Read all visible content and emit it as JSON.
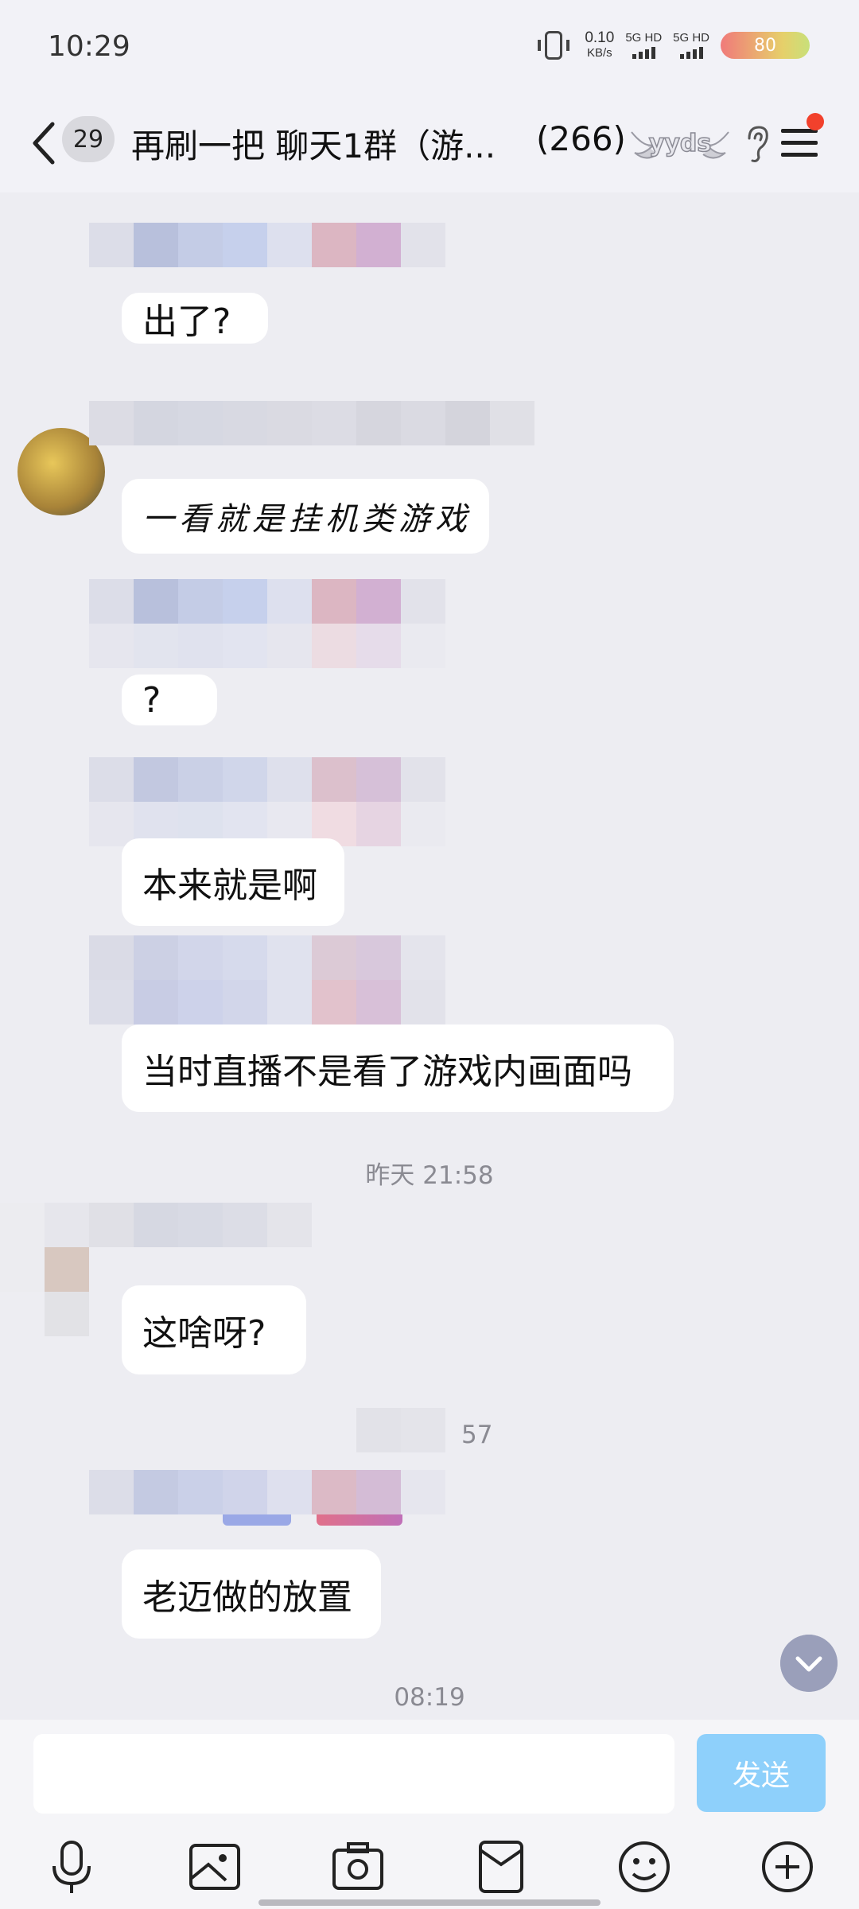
{
  "status_bar": {
    "time": "10:29",
    "net_speed": "0.10",
    "net_unit": "KB/s",
    "sim1": "5G HD",
    "sim2": "5G HD",
    "battery": "80"
  },
  "header": {
    "unread_count": "29",
    "title": "再刷一把 聊天1群（游...",
    "member_count": "(266)",
    "badge_text": "yyds",
    "icons": [
      "back-icon",
      "ear-icon",
      "menu-icon"
    ]
  },
  "messages": [
    {
      "text": "出了?"
    },
    {
      "text": "一看就是挂机类游戏"
    },
    {
      "text": "?"
    },
    {
      "text": "本来就是啊"
    },
    {
      "text": "当时直播不是看了游戏内画面吗"
    },
    {
      "text": "这啥呀?"
    },
    {
      "text": "老迈做的放置"
    }
  ],
  "timestamps": {
    "yesterday": "昨天 21:58",
    "partial": "57",
    "bottom": "08:19"
  },
  "input": {
    "placeholder": "",
    "send_label": "发送"
  },
  "toolbar": [
    "microphone-icon",
    "image-icon",
    "camera-icon",
    "red-packet-icon",
    "emoji-icon",
    "plus-icon"
  ],
  "colors": {
    "background": "#ededf2",
    "bubble": "#ffffff",
    "send_button": "#8ed0fb",
    "notification_dot": "#f2412c"
  }
}
